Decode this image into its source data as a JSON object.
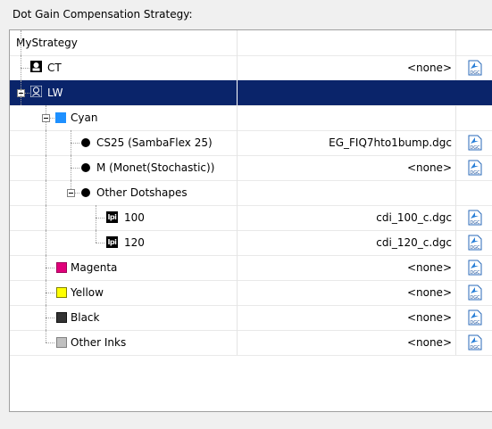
{
  "group": {
    "title": "Dot Gain Compensation Strategy:"
  },
  "colors": {
    "selected_bg": "#0a246a",
    "cyan": "#1e90ff",
    "magenta": "#e0007a",
    "yellow": "#ffff00",
    "black": "#333333",
    "other": "#c0c0c0"
  },
  "tree": {
    "root": {
      "label": "MyStrategy"
    },
    "rows": [
      {
        "id": "ct",
        "label": "CT",
        "value": "<none>",
        "icon": "screening-head-icon"
      },
      {
        "id": "lw",
        "label": "LW",
        "value": "",
        "icon": "screening-head-icon",
        "selected": true
      },
      {
        "id": "cyan",
        "label": "Cyan",
        "value": "",
        "icon": "cyan-swatch-icon"
      },
      {
        "id": "cs25",
        "label": "CS25 (SambaFlex 25)",
        "value": "EG_FIQ7hto1bump.dgc",
        "icon": "dotshape-icon"
      },
      {
        "id": "monet",
        "label": "M (Monet(Stochastic))",
        "value": "<none>",
        "icon": "dotshape-icon"
      },
      {
        "id": "other-dot",
        "label": "Other Dotshapes",
        "value": "",
        "icon": "dotshape-icon"
      },
      {
        "id": "lpi100",
        "label": "100",
        "value": "cdi_100_c.dgc",
        "icon": "lpi-icon",
        "icon_text": "lpi"
      },
      {
        "id": "lpi120",
        "label": "120",
        "value": "cdi_120_c.dgc",
        "icon": "lpi-icon",
        "icon_text": "lpi"
      },
      {
        "id": "magenta",
        "label": "Magenta",
        "value": "<none>",
        "icon": "magenta-swatch-icon"
      },
      {
        "id": "yellow",
        "label": "Yellow",
        "value": "<none>",
        "icon": "yellow-swatch-icon"
      },
      {
        "id": "black",
        "label": "Black",
        "value": "<none>",
        "icon": "black-swatch-icon"
      },
      {
        "id": "other-inks",
        "label": "Other Inks",
        "value": "<none>",
        "icon": "other-ink-swatch-icon"
      }
    ]
  },
  "dgc_icon": {
    "text": "DGC"
  }
}
